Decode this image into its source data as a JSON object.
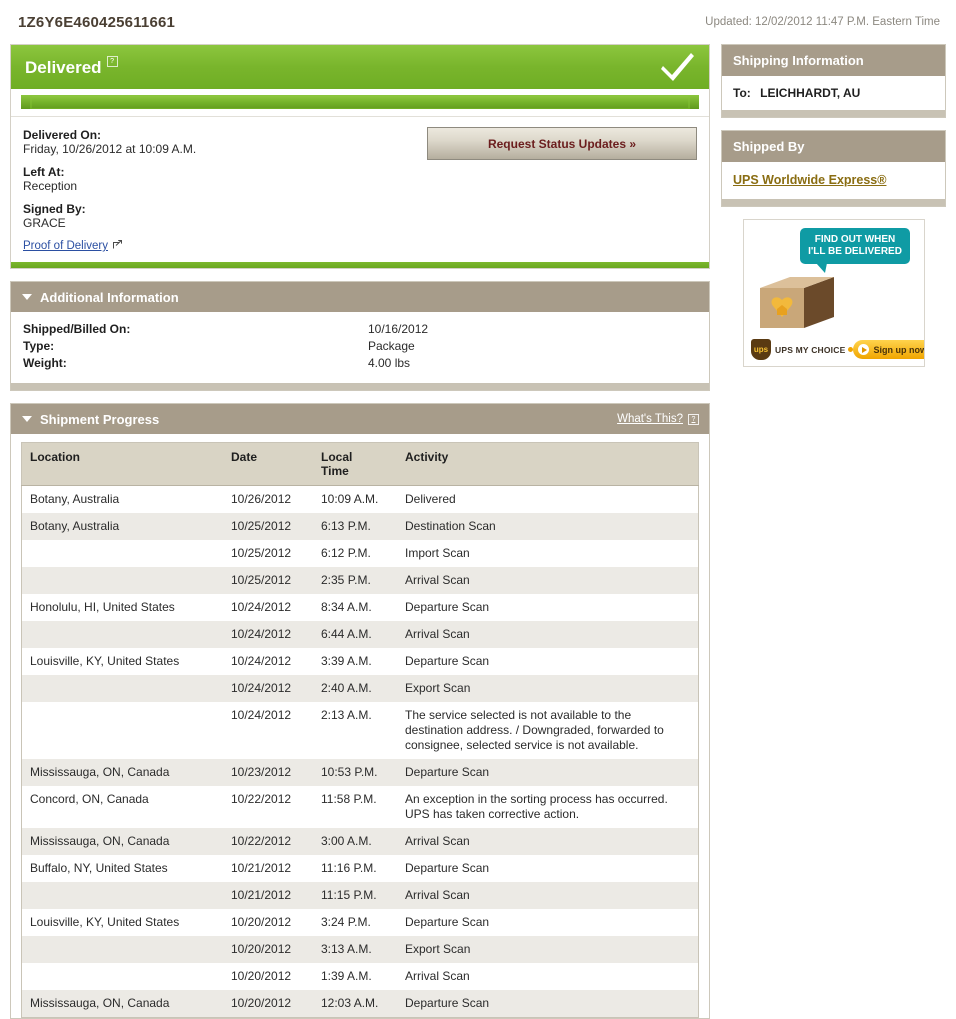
{
  "header": {
    "tracking_number": "1Z6Y6E460425611661",
    "updated_text": "Updated: 12/02/2012 11:47 P.M. Eastern Time"
  },
  "status": {
    "label": "Delivered",
    "help_icon_char": "?",
    "progress_percent": 100,
    "check_icon": "check-mark",
    "delivered_on_label": "Delivered On:",
    "delivered_on_value": "Friday,  10/26/2012 at 10:09 A.M.",
    "left_at_label": "Left At:",
    "left_at_value": "Reception",
    "signed_by_label": "Signed By:",
    "signed_by_value": "GRACE",
    "proof_of_delivery_label": "Proof of Delivery",
    "request_updates_label": "Request Status Updates »",
    "accent_color": "#7ab82d"
  },
  "additional_information": {
    "title": "Additional Information",
    "rows": [
      {
        "label": "Shipped/Billed On:",
        "value": "10/16/2012"
      },
      {
        "label": "Type:",
        "value": "Package"
      },
      {
        "label": "Weight:",
        "value": "4.00 lbs"
      }
    ]
  },
  "shipment_progress": {
    "title": "Shipment Progress",
    "whats_this_label": "What's This?",
    "columns": [
      "Location",
      "Date",
      "Local Time",
      "Activity"
    ],
    "rows": [
      {
        "location": "Botany, Australia",
        "date": "10/26/2012",
        "time": "10:09 A.M.",
        "activity": "Delivered"
      },
      {
        "location": "Botany, Australia",
        "date": "10/25/2012",
        "time": "6:13 P.M.",
        "activity": "Destination Scan"
      },
      {
        "location": "",
        "date": "10/25/2012",
        "time": "6:12 P.M.",
        "activity": "Import Scan"
      },
      {
        "location": "",
        "date": "10/25/2012",
        "time": "2:35 P.M.",
        "activity": "Arrival Scan"
      },
      {
        "location": "Honolulu, HI, United States",
        "date": "10/24/2012",
        "time": "8:34 A.M.",
        "activity": "Departure Scan"
      },
      {
        "location": "",
        "date": "10/24/2012",
        "time": "6:44 A.M.",
        "activity": "Arrival Scan"
      },
      {
        "location": "Louisville, KY, United States",
        "date": "10/24/2012",
        "time": "3:39 A.M.",
        "activity": "Departure Scan"
      },
      {
        "location": "",
        "date": "10/24/2012",
        "time": "2:40 A.M.",
        "activity": "Export Scan"
      },
      {
        "location": "",
        "date": "10/24/2012",
        "time": "2:13 A.M.",
        "activity": "The service selected is not available to the destination address. / Downgraded, forwarded to consignee, selected service is not available."
      },
      {
        "location": "Mississauga, ON, Canada",
        "date": "10/23/2012",
        "time": "10:53 P.M.",
        "activity": "Departure Scan"
      },
      {
        "location": "Concord, ON, Canada",
        "date": "10/22/2012",
        "time": "11:58 P.M.",
        "activity": "An exception in the sorting process has occurred.  UPS has taken corrective action."
      },
      {
        "location": "Mississauga, ON, Canada",
        "date": "10/22/2012",
        "time": "3:00 A.M.",
        "activity": "Arrival Scan"
      },
      {
        "location": "Buffalo, NY, United States",
        "date": "10/21/2012",
        "time": "11:16 P.M.",
        "activity": "Departure Scan"
      },
      {
        "location": "",
        "date": "10/21/2012",
        "time": "11:15 P.M.",
        "activity": "Arrival Scan"
      },
      {
        "location": "Louisville, KY, United States",
        "date": "10/20/2012",
        "time": "3:24 P.M.",
        "activity": "Departure Scan"
      },
      {
        "location": "",
        "date": "10/20/2012",
        "time": "3:13 A.M.",
        "activity": "Export Scan"
      },
      {
        "location": "",
        "date": "10/20/2012",
        "time": "1:39 A.M.",
        "activity": "Arrival Scan"
      },
      {
        "location": "Mississauga, ON, Canada",
        "date": "10/20/2012",
        "time": "12:03 A.M.",
        "activity": "Departure Scan"
      }
    ]
  },
  "sidebar": {
    "shipping_information": {
      "title": "Shipping Information",
      "to_label": "To:",
      "to_value": "LEICHHARDT, AU"
    },
    "shipped_by": {
      "title": "Shipped By",
      "service_name": "UPS Worldwide Express®"
    },
    "ad": {
      "bubble_line1": "FIND OUT WHEN",
      "bubble_line2": "I'LL BE DELIVERED",
      "brand_mark": "ups",
      "brand_text": "UPS MY CHOICE",
      "cta_label": "Sign up now"
    }
  }
}
